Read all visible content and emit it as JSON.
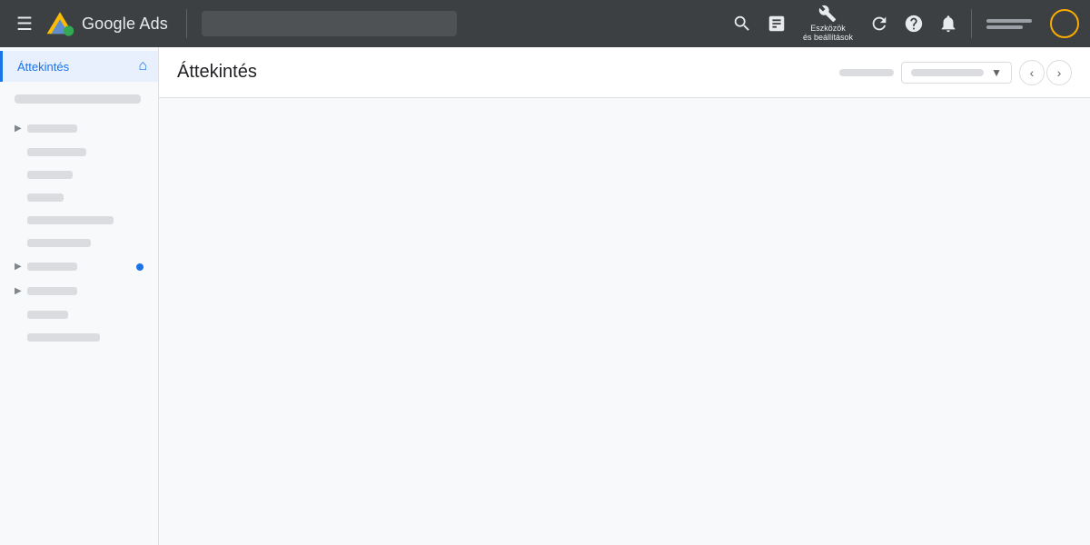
{
  "topnav": {
    "title": "Google Ads",
    "hamburger_label": "☰",
    "search_placeholder": "",
    "tools_label": "Eszközök\nés beállítások",
    "account_label": ""
  },
  "sidebar": {
    "active_item": "Áttekintés",
    "items": [
      {
        "label": "——————",
        "has_chevron": false,
        "has_dot": false
      },
      {
        "label": "————",
        "has_chevron": true,
        "has_dot": false
      },
      {
        "label": "—————",
        "has_chevron": false,
        "has_dot": false
      },
      {
        "label": "————",
        "has_chevron": false,
        "has_dot": false
      },
      {
        "label": "———",
        "has_chevron": false,
        "has_dot": false
      },
      {
        "label": "——————————",
        "has_chevron": false,
        "has_dot": false
      },
      {
        "label": "———————",
        "has_chevron": false,
        "has_dot": false
      },
      {
        "label": "————",
        "has_chevron": true,
        "has_dot": true
      },
      {
        "label": "————",
        "has_chevron": true,
        "has_dot": false
      },
      {
        "label": "————",
        "has_chevron": false,
        "has_dot": false
      },
      {
        "label": "——————",
        "has_chevron": false,
        "has_dot": false
      }
    ]
  },
  "main": {
    "title": "Áttekintés",
    "dropdown_placeholder": "——————————",
    "nav_prev": "‹",
    "nav_next": "›"
  }
}
